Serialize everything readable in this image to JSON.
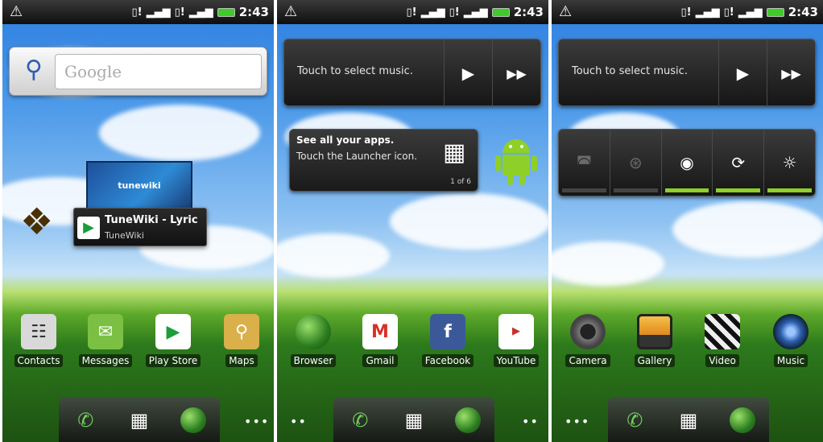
{
  "status_bar": {
    "warning_glyph": "⚠",
    "sim1_glyph": "▯!",
    "signal1_glyph": "▂▄▆",
    "sim2_glyph": "▯!",
    "signal2_glyph": "▂▄▆",
    "time": "2:43"
  },
  "screen1": {
    "search": {
      "placeholder": "Google"
    },
    "drag_preview": {
      "thumb_text": "tunewiki",
      "title": "TuneWiki - Lyric",
      "subtitle": "TuneWiki"
    },
    "apps": [
      {
        "label": "Contacts",
        "color": "#d9d9d9"
      },
      {
        "label": "Messages",
        "color": "#7bc043"
      },
      {
        "label": "Play Store",
        "color": "#ffffff"
      },
      {
        "label": "Maps",
        "color": "#d9b04a"
      }
    ]
  },
  "screen2": {
    "music_widget": {
      "label": "Touch to select music."
    },
    "tooltip": {
      "title": "See all your apps.",
      "body": "Touch the Launcher icon.",
      "page": "1 of 6"
    },
    "apps": [
      {
        "label": "Browser",
        "color": "#3f8f2e"
      },
      {
        "label": "Gmail",
        "color": "#ffffff"
      },
      {
        "label": "Facebook",
        "color": "#3b5998"
      },
      {
        "label": "YouTube",
        "color": "#c4302b"
      }
    ]
  },
  "screen3": {
    "music_widget": {
      "label": "Touch to select music."
    },
    "power_widget": [
      {
        "name": "wifi",
        "state": "off"
      },
      {
        "name": "bluetooth",
        "state": "off"
      },
      {
        "name": "gps",
        "state": "on"
      },
      {
        "name": "sync",
        "state": "on"
      },
      {
        "name": "brightness",
        "state": "on"
      }
    ],
    "apps": [
      {
        "label": "Camera",
        "color": "#555555"
      },
      {
        "label": "Gallery",
        "color": "#3a3a3a"
      },
      {
        "label": "Video",
        "color": "#2a2a2a"
      },
      {
        "label": "Music",
        "color": "#2c5fb0"
      }
    ]
  }
}
